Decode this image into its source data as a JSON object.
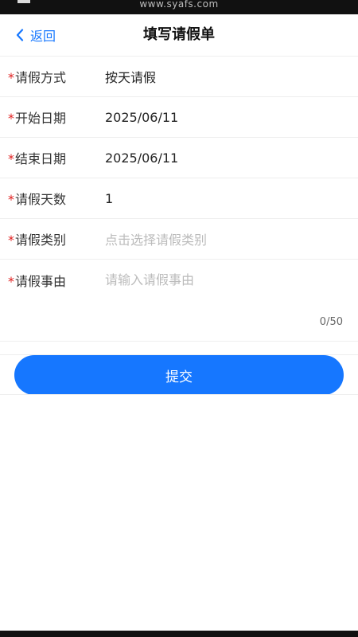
{
  "status_bar": {
    "watermark": "www.syafs.com"
  },
  "nav": {
    "back_label": "返回",
    "title": "填写请假单"
  },
  "form": {
    "required_mark": "*",
    "fields": [
      {
        "label": "请假方式",
        "value": "按天请假"
      },
      {
        "label": "开始日期",
        "value": "2025/06/11"
      },
      {
        "label": "结束日期",
        "value": "2025/06/11"
      },
      {
        "label": "请假天数",
        "value": "1"
      },
      {
        "label": "请假类别",
        "placeholder": "点击选择请假类别"
      }
    ],
    "reason": {
      "label": "请假事由",
      "placeholder": "请输入请假事由",
      "counter": "0/50"
    }
  },
  "submit_label": "提交",
  "colors": {
    "accent": "#1677ff",
    "required": "#e02020",
    "placeholder": "#bbbbbb"
  }
}
